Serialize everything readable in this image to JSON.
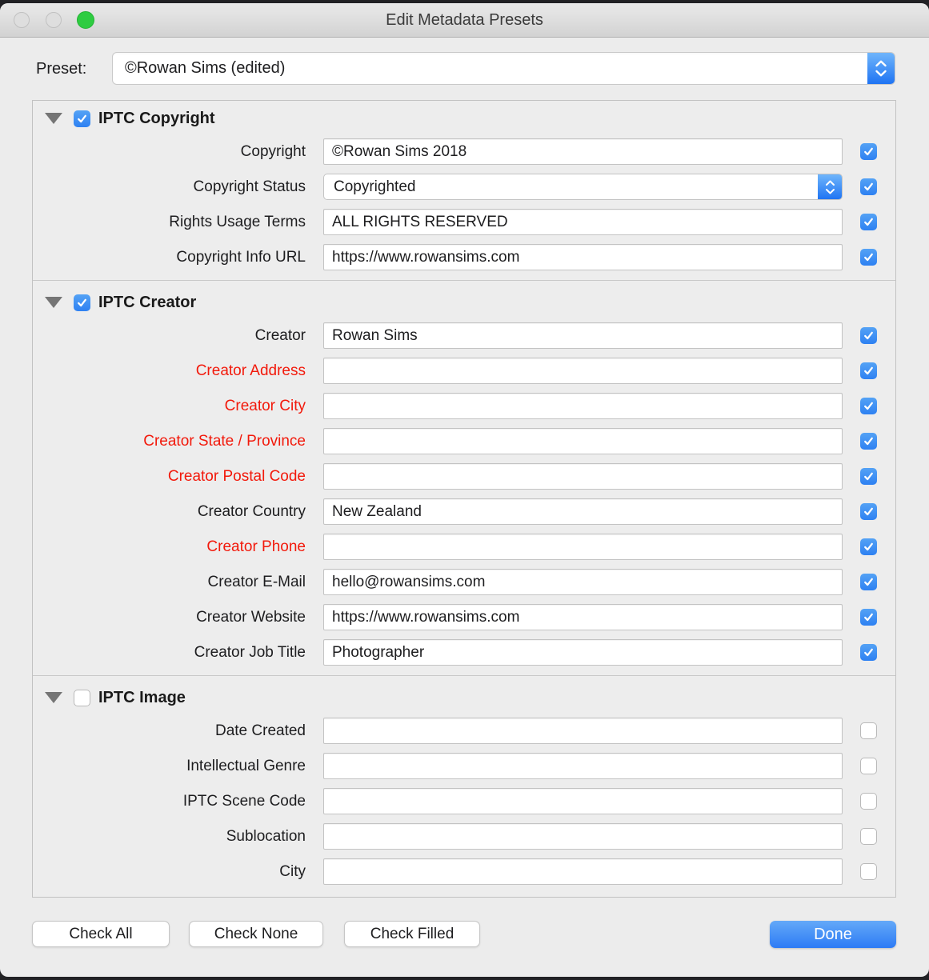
{
  "window": {
    "title": "Edit Metadata Presets"
  },
  "preset": {
    "label": "Preset:",
    "value": "©Rowan Sims (edited)"
  },
  "sections": [
    {
      "title": "IPTC Copyright",
      "checked": true,
      "rows": [
        {
          "label": "Copyright",
          "value": "©Rowan Sims 2018",
          "type": "text",
          "checked": true,
          "red": false
        },
        {
          "label": "Copyright Status",
          "value": "Copyrighted",
          "type": "popup",
          "checked": true,
          "red": false
        },
        {
          "label": "Rights Usage Terms",
          "value": "ALL RIGHTS RESERVED",
          "type": "text",
          "checked": true,
          "red": false
        },
        {
          "label": "Copyright Info URL",
          "value": "https://www.rowansims.com",
          "type": "text",
          "checked": true,
          "red": false
        }
      ]
    },
    {
      "title": "IPTC Creator",
      "checked": true,
      "rows": [
        {
          "label": "Creator",
          "value": "Rowan Sims",
          "type": "text",
          "checked": true,
          "red": false
        },
        {
          "label": "Creator Address",
          "value": "",
          "type": "text",
          "checked": true,
          "red": true
        },
        {
          "label": "Creator City",
          "value": "",
          "type": "text",
          "checked": true,
          "red": true
        },
        {
          "label": "Creator State / Province",
          "value": "",
          "type": "text",
          "checked": true,
          "red": true
        },
        {
          "label": "Creator Postal Code",
          "value": "",
          "type": "text",
          "checked": true,
          "red": true
        },
        {
          "label": "Creator Country",
          "value": "New Zealand",
          "type": "text",
          "checked": true,
          "red": false
        },
        {
          "label": "Creator Phone",
          "value": "",
          "type": "text",
          "checked": true,
          "red": true
        },
        {
          "label": "Creator E-Mail",
          "value": "hello@rowansims.com",
          "type": "text",
          "checked": true,
          "red": false
        },
        {
          "label": "Creator Website",
          "value": "https://www.rowansims.com",
          "type": "text",
          "checked": true,
          "red": false
        },
        {
          "label": "Creator Job Title",
          "value": "Photographer",
          "type": "text",
          "checked": true,
          "red": false
        }
      ]
    },
    {
      "title": "IPTC Image",
      "checked": false,
      "rows": [
        {
          "label": "Date Created",
          "value": "",
          "type": "text",
          "checked": false,
          "red": false
        },
        {
          "label": "Intellectual Genre",
          "value": "",
          "type": "text",
          "checked": false,
          "red": false
        },
        {
          "label": "IPTC Scene Code",
          "value": "",
          "type": "text",
          "checked": false,
          "red": false
        },
        {
          "label": "Sublocation",
          "value": "",
          "type": "text",
          "checked": false,
          "red": false
        },
        {
          "label": "City",
          "value": "",
          "type": "text",
          "checked": false,
          "red": false
        }
      ]
    }
  ],
  "footer": {
    "check_all": "Check All",
    "check_none": "Check None",
    "check_filled": "Check Filled",
    "done": "Done"
  },
  "icons": {
    "disclosure": "triangle-down",
    "stepper": "up-down-chevrons",
    "checkbox_check": "checkmark"
  },
  "colors": {
    "accent_blue": "#2e81f2",
    "required_red": "#f2190b",
    "traffic_green": "#2ecc41",
    "dialog_background": "#ececec"
  }
}
